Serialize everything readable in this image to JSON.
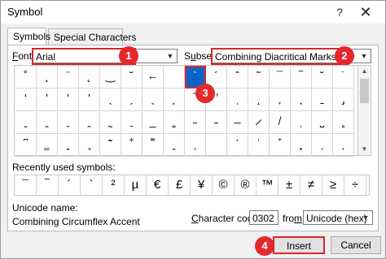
{
  "window": {
    "title": "Symbol",
    "help_glyph": "?",
    "close_glyph": "✕"
  },
  "tabs": [
    {
      "label": "Symbols",
      "active": true
    },
    {
      "label": "Special Characters",
      "active": false
    }
  ],
  "font": {
    "label_prefix": "F",
    "label_rest": "ont:",
    "value": "Arial"
  },
  "subset": {
    "label_pre": "S",
    "label_ul": "u",
    "label_rest": "bset:",
    "value": "Combining Diacritical Marks"
  },
  "grid": {
    "rows": [
      [
        "˚",
        "¸",
        "¨",
        "˛",
        "‿",
        "˘",
        "←",
        "",
        "`",
        "´",
        "ˆ",
        "˜",
        "¯",
        "‾",
        "˘",
        "˙",
        "¨",
        "̉",
        "˚",
        "˝",
        "ˇ",
        "̍",
        "̎",
        "̏",
        "̐",
        "̑"
      ],
      [
        "̒",
        "̓",
        "̔",
        "̕",
        "̖",
        "̗",
        "̘",
        "̙",
        "̚",
        "̛",
        "̜",
        "̝",
        "̞",
        "̟",
        "̠",
        "̡",
        "̢",
        "̣",
        "̤",
        "̥",
        "̦",
        "̧",
        "̨",
        "̩",
        "̪",
        "̫"
      ],
      [
        "̬",
        "̭",
        "̮",
        "̯",
        "̰",
        "̱",
        "̲",
        "̳",
        "̴",
        "̵",
        "̶",
        "̷",
        "̸",
        "̹",
        "̺",
        "̻",
        "̼",
        "̽",
        "̾",
        "̿",
        "̀",
        "́",
        "͂",
        "̓",
        "̈́",
        "ͅ"
      ],
      [
        "͆",
        "͇",
        "͈",
        "͉",
        "͊",
        "͋",
        "͌",
        "͍",
        "͎",
        "͏",
        "͐",
        "͑",
        "͒",
        "͓",
        "͔",
        "͕",
        "͖",
        "͗",
        "͘",
        "͙",
        "͚",
        "͛",
        "͜",
        "͝",
        "͞",
        "͟"
      ]
    ],
    "selected_row": 0,
    "selected_col": 8
  },
  "recent": {
    "label": "Recently used symbols:",
    "label_ul_char": "R",
    "symbols": [
      "¯",
      "‾",
      "´",
      "`",
      "²",
      "µ",
      "€",
      "£",
      "¥",
      "©",
      "®",
      "™",
      "±",
      "≠",
      "≥",
      "÷"
    ]
  },
  "unicode": {
    "name_label": "Unicode name:",
    "name_value": "Combining Circumflex Accent"
  },
  "charcode": {
    "label_pre": "",
    "label_ul": "C",
    "label_rest": "haracter code:",
    "value": "0302"
  },
  "from": {
    "label_pre": "fro",
    "label_ul": "m",
    "label_rest": ":",
    "value": "Unicode (hex)"
  },
  "buttons": {
    "insert": "Insert",
    "cancel": "Cancel"
  },
  "badges": [
    "1",
    "2",
    "3",
    "4"
  ],
  "colors": {
    "annotation_red": "#d9262a",
    "selection_blue": "#0a64c8"
  }
}
